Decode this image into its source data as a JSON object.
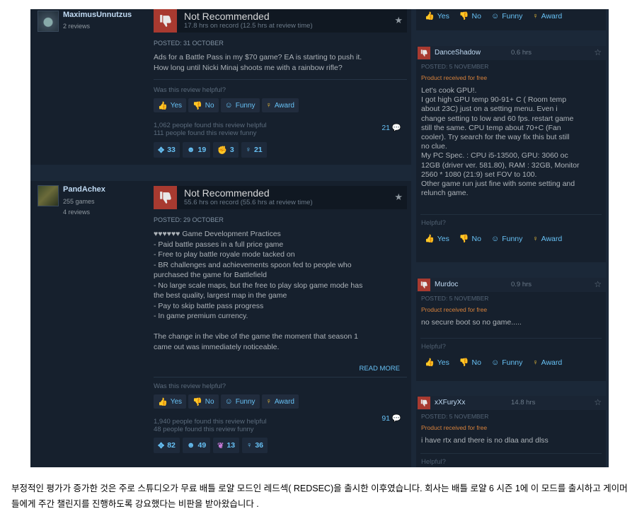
{
  "review1": {
    "author": {
      "name": "MaximusUnnutzus",
      "reviews": "2 reviews"
    },
    "verdict": "Not Recommended",
    "hours": "17.8 hrs on record (12.5 hrs at review time)",
    "posted": "POSTED: 31 OCTOBER",
    "text": "Ads for a Battle Pass in my $70 game? EA is starting to push it.\nHow long until Nicki Minaj shoots me with a rainbow rifle?",
    "helpful_q": "Was this review helpful?",
    "buttons": {
      "yes": "Yes",
      "no": "No",
      "funny": "Funny",
      "award": "Award"
    },
    "found_helpful": "1,062 people found this review helpful",
    "found_funny": "111 people found this review funny",
    "comments": "21",
    "awards": [
      "33",
      "19",
      "3",
      "21"
    ]
  },
  "review2": {
    "author": {
      "name": "PandAchex",
      "games": "255 games",
      "reviews": "4 reviews"
    },
    "verdict": "Not Recommended",
    "hours": "55.6 hrs on record (55.6 hrs at review time)",
    "posted": "POSTED: 29 OCTOBER",
    "text": "♥♥♥♥♥♥ Game Development Practices\n- Paid battle passes in a full price game\n- Free to play battle royale mode tacked on\n- BR challenges and achievements spoon fed to people who\npurchased the game for Battlefield\n- No large scale maps, but the free to play slop game mode has\nthe best quality, largest map in the game\n- Pay to skip battle pass progress\n- In game premium currency.\n\nThe change in the vibe of the game the moment that season 1\ncame out was immediately noticeable.",
    "read_more": "READ MORE",
    "helpful_q": "Was this review helpful?",
    "buttons": {
      "yes": "Yes",
      "no": "No",
      "funny": "Funny",
      "award": "Award"
    },
    "found_helpful": "1,940 people found this review helpful",
    "found_funny": "48 people found this review funny",
    "comments": "91",
    "awards": [
      "82",
      "49",
      "13",
      "36"
    ]
  },
  "right_top_buttons": {
    "yes": "Yes",
    "no": "No",
    "funny": "Funny",
    "award": "Award"
  },
  "right_reviews": [
    {
      "name": "DanceShadow",
      "hours": "0.6 hrs",
      "posted": "POSTED: 5 NOVEMBER",
      "free": "Product received for free",
      "text": "Let's cook GPU!.\nI got high GPU temp 90-91+ C ( Room temp\nabout 23C) just on a setting menu. Even i\nchange setting to low and 60 fps. restart game\nstill the same. CPU temp about 70+C (Fan\ncooler). Try search for the way fix this but still\nno clue.\nMy PC Spec. : CPU i5-13500, GPU: 3060 oc\n12GB (driver ver. 581.80), RAM : 32GB, Monitor\n2560 * 1080 (21:9) set FOV to 100.\nOther game run just fine with some setting and\nrelunch game.",
      "helpful": "Helpful?",
      "buttons": {
        "yes": "Yes",
        "no": "No",
        "funny": "Funny",
        "award": "Award"
      }
    },
    {
      "name": "Murdoc",
      "hours": "0.9 hrs",
      "posted": "POSTED: 5 NOVEMBER",
      "free": "Product received for free",
      "text": "no secure boot so no game.....",
      "helpful": "Helpful?",
      "buttons": {
        "yes": "Yes",
        "no": "No",
        "funny": "Funny",
        "award": "Award"
      }
    },
    {
      "name": "xXFuryXx",
      "hours": "14.8 hrs",
      "posted": "POSTED: 5 NOVEMBER",
      "free": "Product received for free",
      "text": "i have rtx and there is no dlaa and dlss",
      "helpful": "Helpful?"
    }
  ],
  "caption": "부정적인 평가가 증가한 것은 주로 스튜디오가 무료 배틀 로얄 모드인 레드섹( REDSEC)을 출시한 이후였습니다. 회사는 배틀 로얄 6 시즌 1에 이 모드를 출시하고 게이머들에게 주간 챌린지를 진행하도록 강요했다는 비판을 받아왔습니다 ."
}
